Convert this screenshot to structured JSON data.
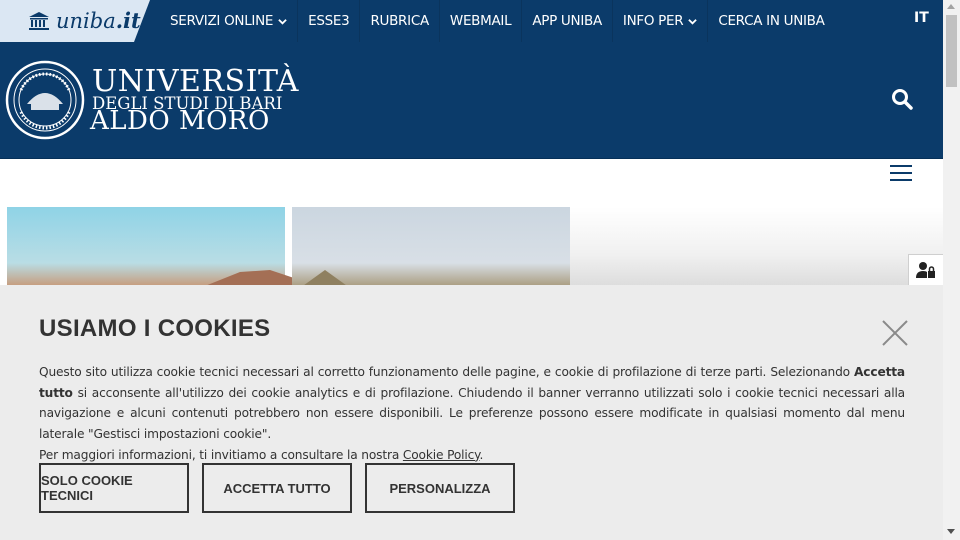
{
  "brand": {
    "prefix": "uniba",
    "suffix": ".it"
  },
  "topnav": [
    {
      "label": "SERVIZI ONLINE",
      "dropdown": true
    },
    {
      "label": "ESSE3",
      "dropdown": false
    },
    {
      "label": "RUBRICA",
      "dropdown": false
    },
    {
      "label": "WEBMAIL",
      "dropdown": false
    },
    {
      "label": "APP UNIBA",
      "dropdown": false
    },
    {
      "label": "INFO PER",
      "dropdown": true
    },
    {
      "label": "CERCA IN UNIBA",
      "dropdown": false
    }
  ],
  "language": "IT",
  "logo": {
    "line1": "UNIVERSITÀ",
    "line2": "DEGLI STUDI DI BARI",
    "line3": "ALDO MORO"
  },
  "cookie_banner": {
    "title": "USIAMO I COOKIES",
    "text_part1": "Questo sito utilizza cookie tecnici necessari al corretto funzionamento delle pagine, e cookie di profilazione di terze parti. Selezionando ",
    "text_bold": "Accetta tutto",
    "text_part2": " si acconsente all'utilizzo dei cookie analytics e di profilazione. Chiudendo il banner verranno utilizzati solo i cookie tecnici necessari alla navigazione e alcuni contenuti potrebbero non essere disponibili. Le preferenze possono essere modificate in qualsiasi momento dal menu laterale \"Gestisci impostazioni cookie\".",
    "text_part3": "Per maggiori informazioni, ti invitiamo a consultare la nostra ",
    "link_label": "Cookie Policy",
    "text_end": ".",
    "buttons": {
      "technical": "SOLO COOKIE TECNICI",
      "accept": "ACCETTA TUTTO",
      "customize": "PERSONALIZZA"
    }
  },
  "colors": {
    "primary": "#0b3b6a",
    "brand_box": "#dbe7f3",
    "banner_bg": "#ececec",
    "text": "#333333"
  },
  "icons": {
    "brand": "building-columns-icon",
    "search": "search-icon",
    "menu": "hamburger-menu-icon",
    "accessibility": "user-lock-icon",
    "close": "close-icon"
  }
}
